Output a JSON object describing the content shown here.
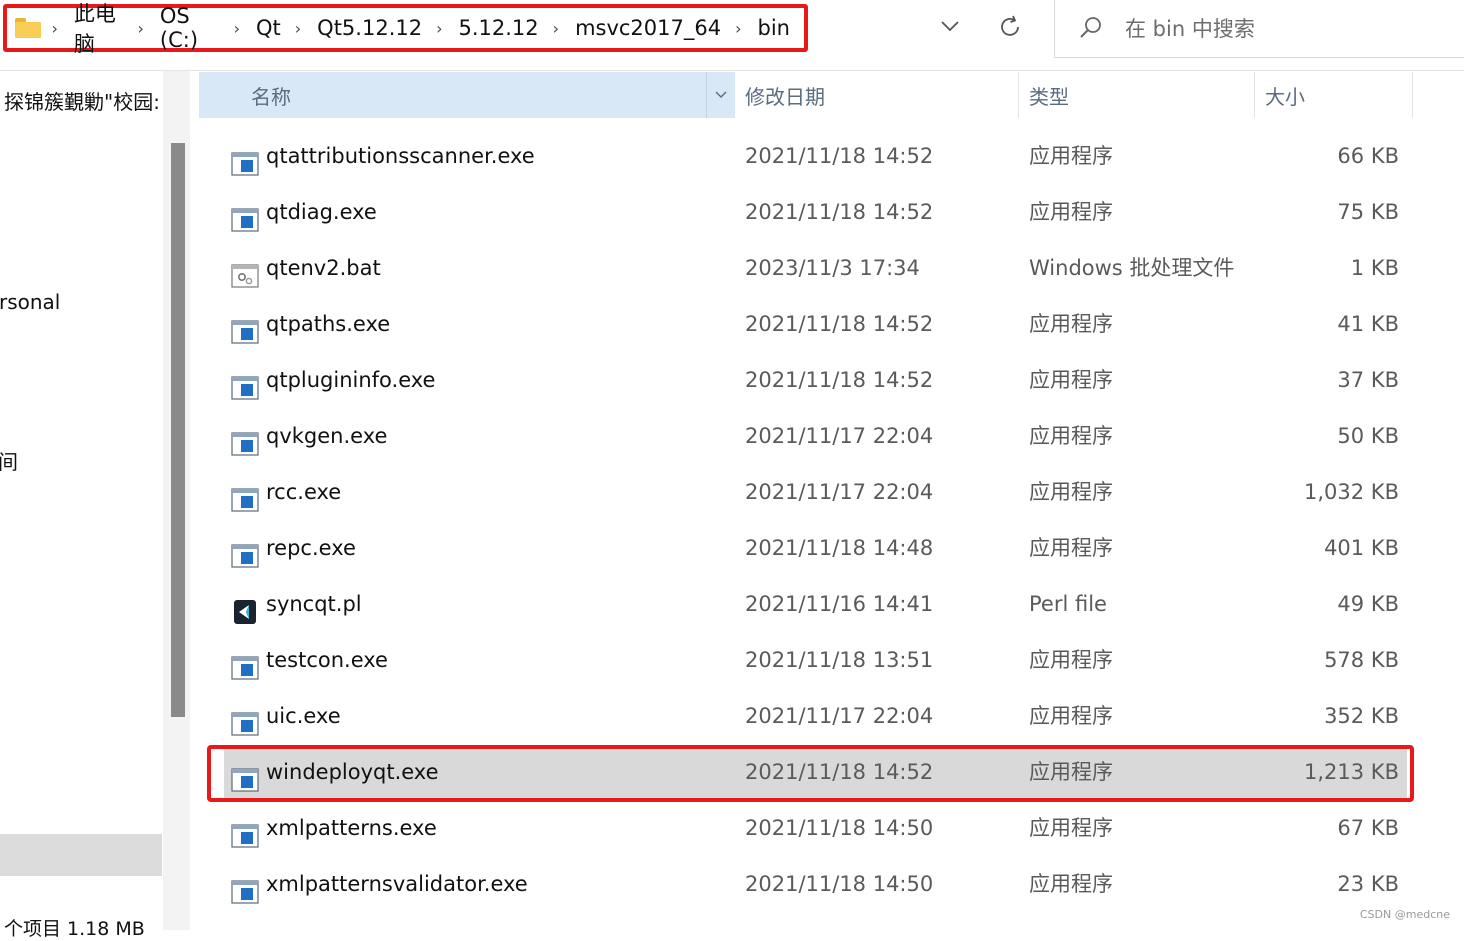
{
  "address_bar": {
    "crumbs": [
      "此电脑",
      "OS (C:)",
      "Qt",
      "Qt5.12.12",
      "5.12.12",
      "msvc2017_64",
      "bin"
    ],
    "search_placeholder": "在 bin 中搜索"
  },
  "nav_pane": {
    "items": [
      "探锦簇覲勦\"校园:",
      "rsonal",
      "间"
    ],
    "status": "个项目  1.18 MB"
  },
  "columns": {
    "name": "名称",
    "date": "修改日期",
    "type": "类型",
    "size": "大小"
  },
  "files": [
    {
      "name": "qtattributionsscanner.exe",
      "date": "2021/11/18 14:52",
      "type": "应用程序",
      "size": "66 KB",
      "icon": "exe-icon"
    },
    {
      "name": "qtdiag.exe",
      "date": "2021/11/18 14:52",
      "type": "应用程序",
      "size": "75 KB",
      "icon": "exe-icon"
    },
    {
      "name": "qtenv2.bat",
      "date": "2023/11/3 17:34",
      "type": "Windows 批处理文件",
      "size": "1 KB",
      "icon": "bat-icon"
    },
    {
      "name": "qtpaths.exe",
      "date": "2021/11/18 14:52",
      "type": "应用程序",
      "size": "41 KB",
      "icon": "exe-icon"
    },
    {
      "name": "qtplugininfo.exe",
      "date": "2021/11/18 14:52",
      "type": "应用程序",
      "size": "37 KB",
      "icon": "exe-icon"
    },
    {
      "name": "qvkgen.exe",
      "date": "2021/11/17 22:04",
      "type": "应用程序",
      "size": "50 KB",
      "icon": "exe-icon"
    },
    {
      "name": "rcc.exe",
      "date": "2021/11/17 22:04",
      "type": "应用程序",
      "size": "1,032 KB",
      "icon": "exe-icon"
    },
    {
      "name": "repc.exe",
      "date": "2021/11/18 14:48",
      "type": "应用程序",
      "size": "401 KB",
      "icon": "exe-icon"
    },
    {
      "name": "syncqt.pl",
      "date": "2021/11/16 14:41",
      "type": "Perl file",
      "size": "49 KB",
      "icon": "perl-icon"
    },
    {
      "name": "testcon.exe",
      "date": "2021/11/18 13:51",
      "type": "应用程序",
      "size": "578 KB",
      "icon": "exe-icon"
    },
    {
      "name": "uic.exe",
      "date": "2021/11/17 22:04",
      "type": "应用程序",
      "size": "352 KB",
      "icon": "exe-icon"
    },
    {
      "name": "windeployqt.exe",
      "date": "2021/11/18 14:52",
      "type": "应用程序",
      "size": "1,213 KB",
      "icon": "exe-icon",
      "selected": true
    },
    {
      "name": "xmlpatterns.exe",
      "date": "2021/11/18 14:50",
      "type": "应用程序",
      "size": "67 KB",
      "icon": "exe-icon"
    },
    {
      "name": "xmlpatternsvalidator.exe",
      "date": "2021/11/18 14:50",
      "type": "应用程序",
      "size": "23 KB",
      "icon": "exe-icon"
    }
  ],
  "watermark": "CSDN @medcne",
  "colors": {
    "highlight_frame": "#e8191b",
    "header_bg": "#d9e8f7",
    "selected_row": "#d9d9d9"
  }
}
